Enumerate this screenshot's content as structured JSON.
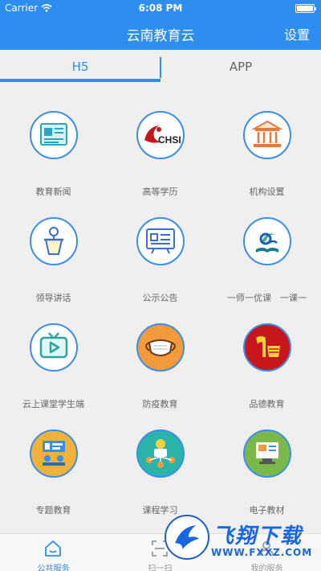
{
  "status_bar": {
    "carrier": "Carrier",
    "time": "6:08 PM"
  },
  "nav": {
    "title": "云南教育云",
    "settings": "设置"
  },
  "tabs": [
    {
      "label": "H5"
    },
    {
      "label": "APP"
    }
  ],
  "grid": [
    {
      "label": "教育新闻",
      "icon": "newspaper-icon"
    },
    {
      "label": "高等学历",
      "icon": "chsi-logo-icon"
    },
    {
      "label": "机构设置",
      "icon": "institution-building-icon"
    },
    {
      "label": "领导讲话",
      "icon": "podium-speech-icon"
    },
    {
      "label": "公示公告",
      "icon": "notice-board-icon"
    },
    {
      "label": "一师一优课　一课一",
      "icon": "book-course-icon"
    },
    {
      "label": "云上课堂学生端",
      "icon": "tv-play-icon"
    },
    {
      "label": "防疫教育",
      "icon": "face-mask-icon"
    },
    {
      "label": "品德教育",
      "icon": "moral-education-icon"
    },
    {
      "label": "专题教育",
      "icon": "topic-education-icon"
    },
    {
      "label": "课程学习",
      "icon": "course-study-icon"
    },
    {
      "label": "电子教材",
      "icon": "e-textbook-icon"
    }
  ],
  "tabbar": [
    {
      "label": "公共服务",
      "icon": "home-icon"
    },
    {
      "label": "扫一扫",
      "icon": "scan-icon"
    },
    {
      "label": "我的服务",
      "icon": "user-icon"
    }
  ],
  "watermark": {
    "title": "飞翔下载",
    "url": "WWW.FXXZ.COM"
  },
  "colors": {
    "primary": "#2e8ef0",
    "background": "#efefef",
    "label": "#666666"
  }
}
